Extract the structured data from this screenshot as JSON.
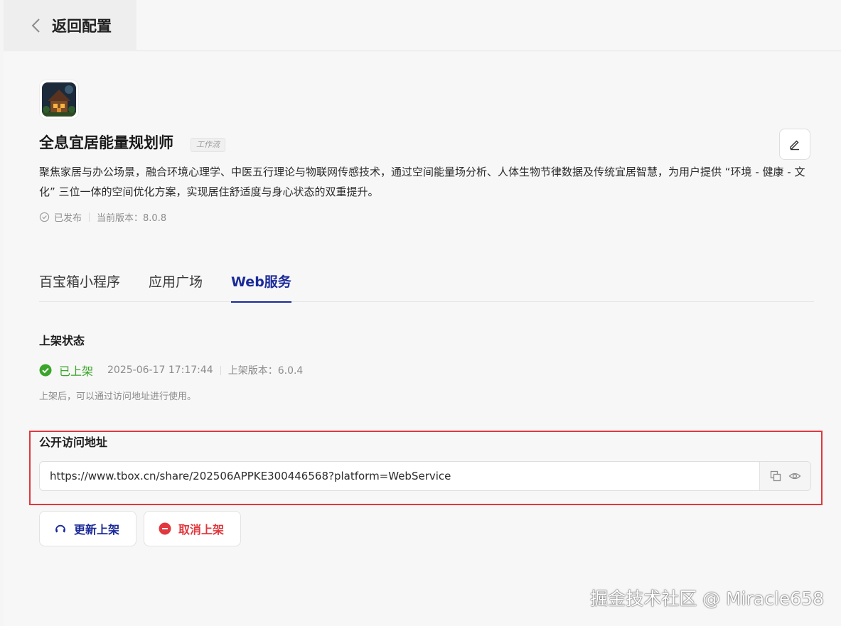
{
  "header": {
    "back_label": "返回配置"
  },
  "app": {
    "title": "全息宜居能量规划师",
    "type_badge": "工作流",
    "description": "聚焦家居与办公场景，融合环境心理学、中医五行理论与物联网传感技术，通过空间能量场分析、人体生物节律数据及传统宜居智慧，为用户提供 “环境 - 健康 - 文化” 三位一体的空间优化方案，实现居住舒适度与身心状态的双重提升。",
    "publish_status": "已发布",
    "current_version": "当前版本：8.0.8"
  },
  "tabs": [
    {
      "label": "百宝箱小程序",
      "active": false
    },
    {
      "label": "应用广场",
      "active": false
    },
    {
      "label": "Web服务",
      "active": true
    }
  ],
  "listing": {
    "section_title": "上架状态",
    "status": "已上架",
    "timestamp": "2025-06-17 17:17:44",
    "listed_version": "上架版本：6.0.4",
    "hint": "上架后，可以通过访问地址进行使用。"
  },
  "public_url": {
    "section_title": "公开访问地址",
    "value": "https://www.tbox.cn/share/202506APPKE300446568?platform=WebService"
  },
  "buttons": {
    "update": "更新上架",
    "cancel": "取消上架"
  },
  "watermark": "掘金技术社区 @ Miracle658",
  "colors": {
    "accent": "#1b2a99",
    "success": "#3aa52a",
    "danger": "#e0383e"
  }
}
